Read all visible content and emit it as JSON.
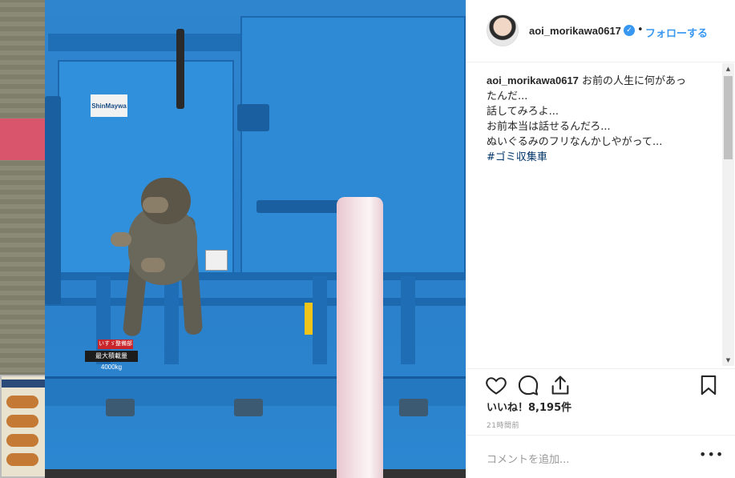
{
  "post": {
    "username": "aoi_morikawa0617",
    "verified": true,
    "separator": "•",
    "follow_label": "フォローする",
    "photo_alt_texts": {
      "brand_plate": "ShinMaywa",
      "weight_red": "いすゞ整備部",
      "weight_black": "最大積載量 4000kg"
    }
  },
  "caption": {
    "username": "aoi_morikawa0617",
    "lines": [
      "お前の人生に何があっ",
      "たんだ...",
      "話してみろよ...",
      "お前本当は話せるんだろ...",
      "ぬいぐるみのフリなんかしやがって...",
      "#ゴミ収集車"
    ]
  },
  "actions": {
    "like_icon": "heart-icon",
    "comment_icon": "comment-icon",
    "share_icon": "share-icon",
    "save_icon": "bookmark-icon"
  },
  "likes": {
    "text": "いいね！8,195件"
  },
  "timestamp": "21時間前",
  "comment": {
    "placeholder": "コメントを追加...",
    "more_label": "•••"
  },
  "scrollbar": {
    "up": "▲",
    "down": "▼"
  },
  "colors": {
    "accent": "#3897f0",
    "hashtag": "#003569",
    "truck_blue": "#2f86cf"
  }
}
